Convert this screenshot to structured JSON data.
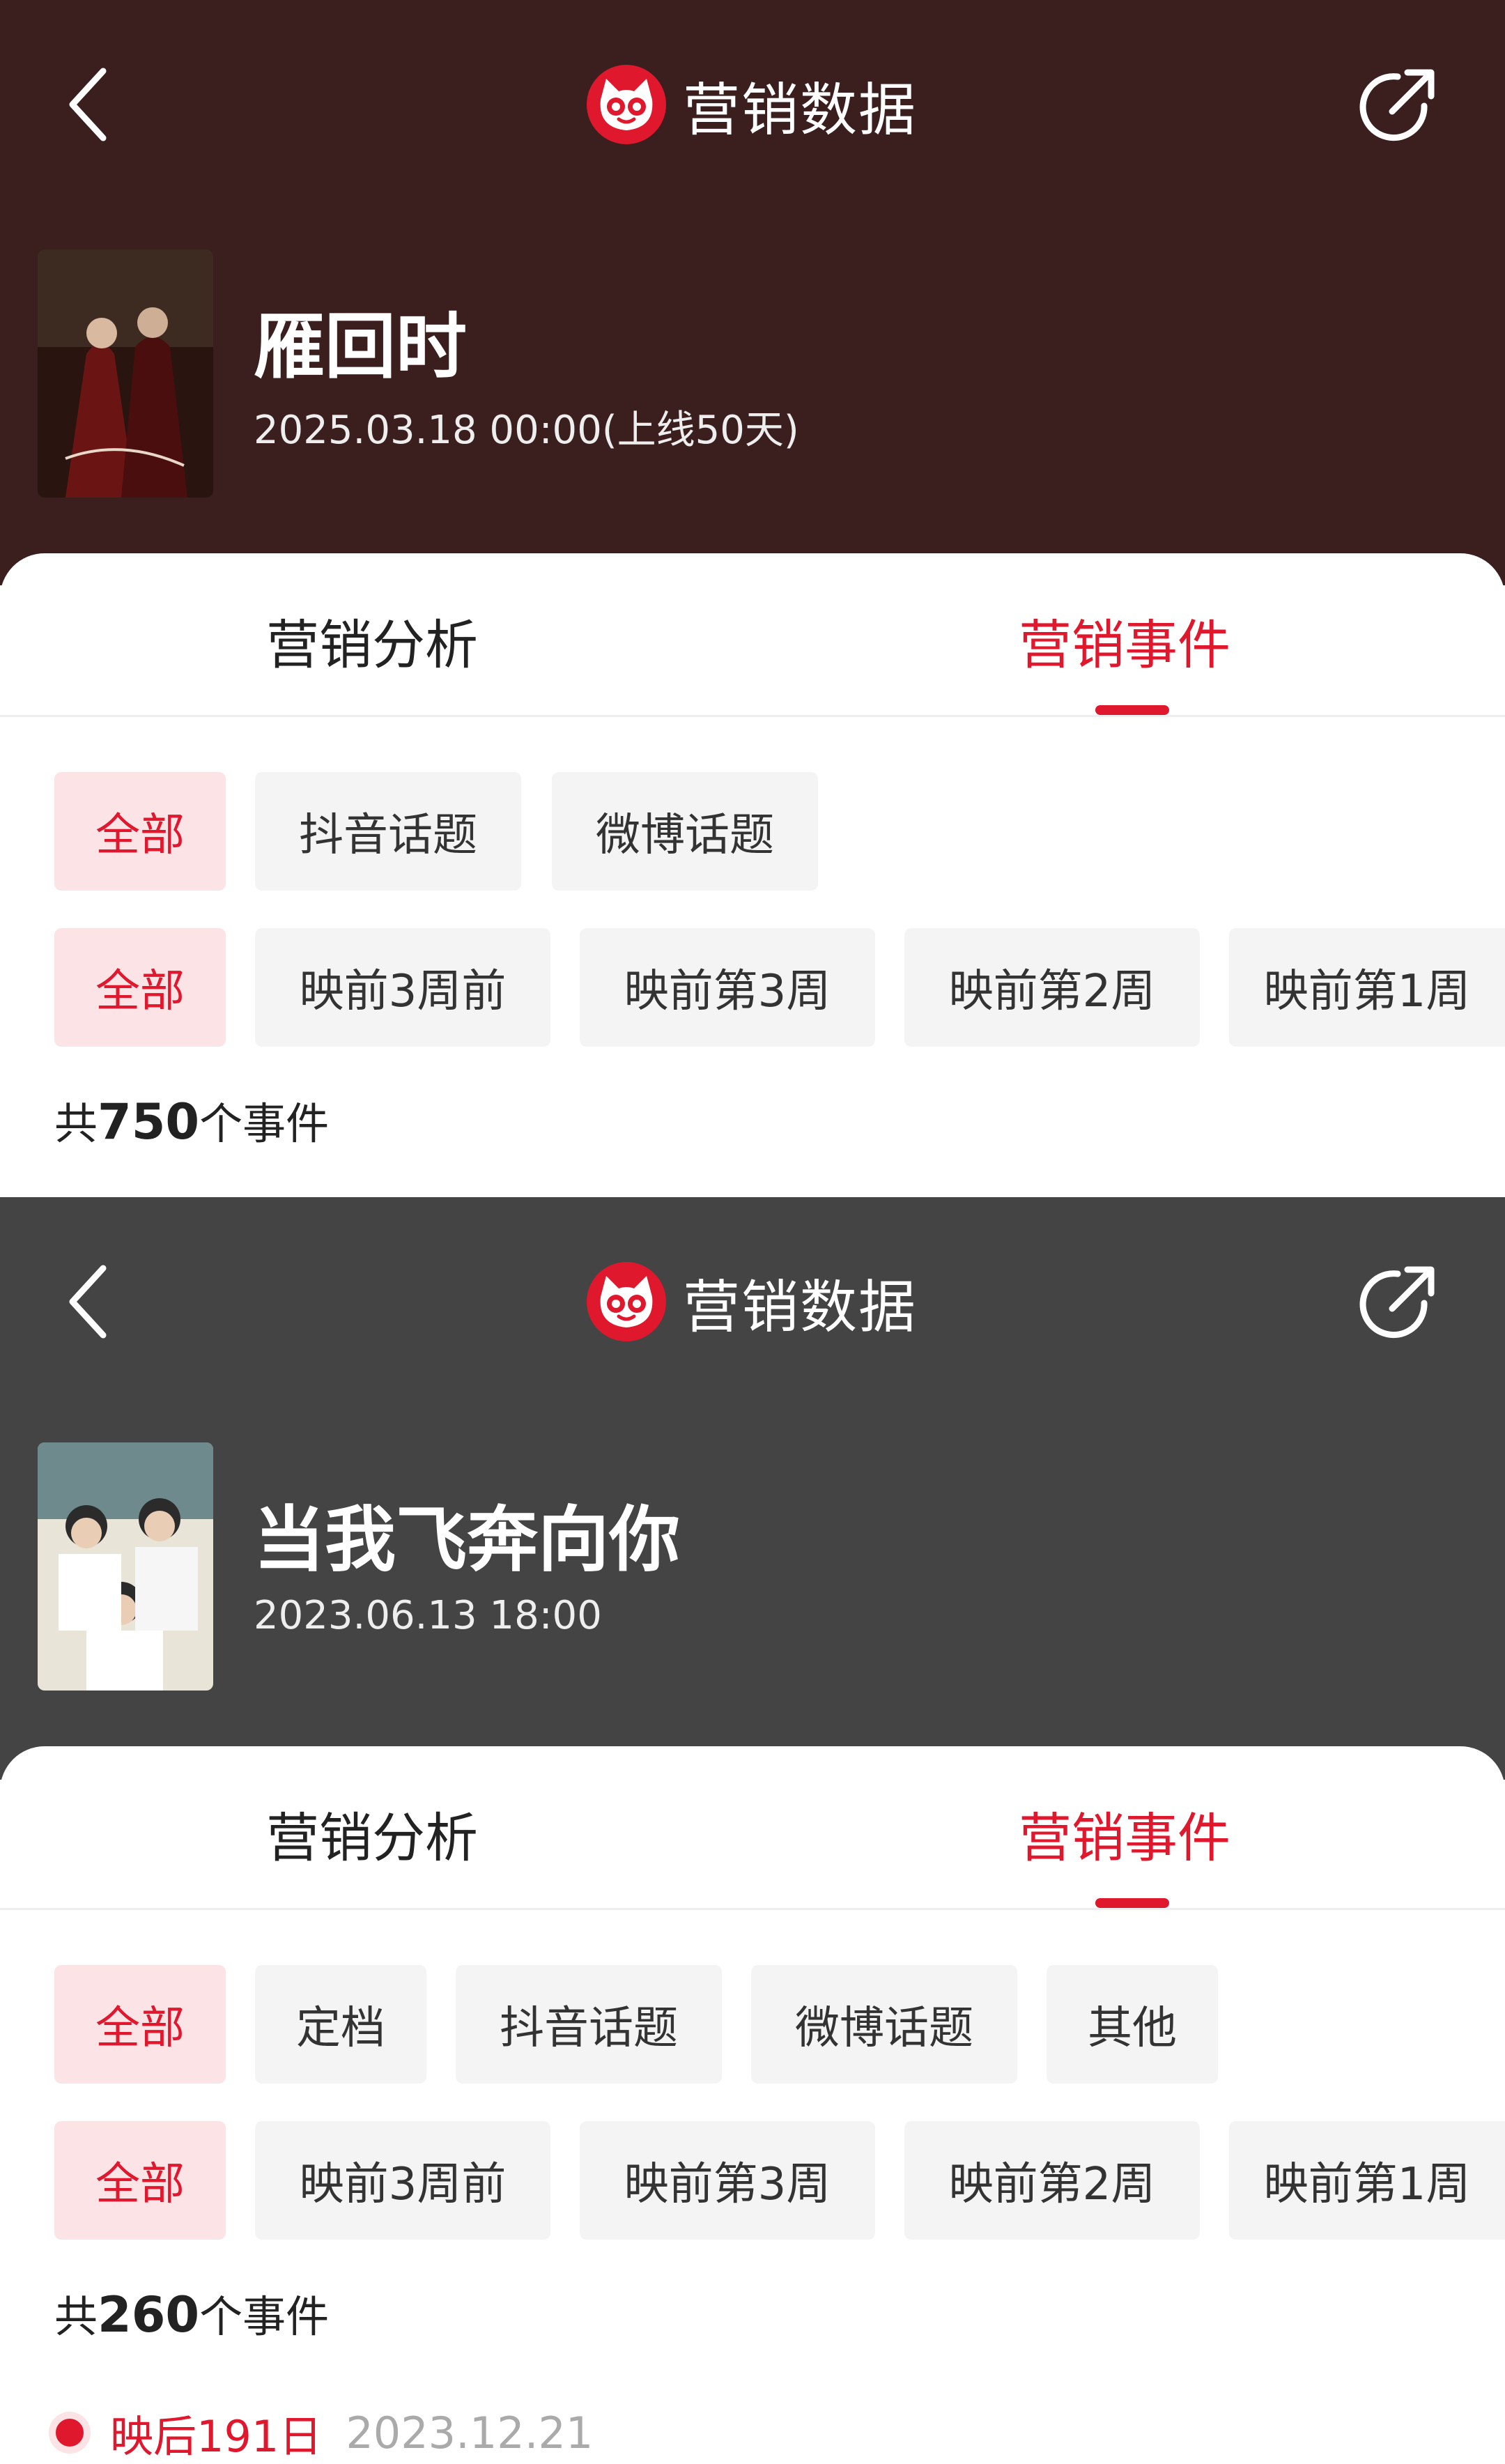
{
  "header": {
    "title": "营销数据"
  },
  "colors": {
    "accent": "#e0182d",
    "hero_bg_1": "#3b1f1f",
    "hero_bg_2": "#444444",
    "chip_active_bg": "#fbe3e6",
    "chip_bg": "#f4f4f4"
  },
  "icons": {
    "back": "chevron-left-icon",
    "share": "share-icon",
    "logo": "cat-logo-icon"
  },
  "panels": [
    {
      "movie": {
        "title": "雁回时",
        "date": "2025.03.18 00:00(上线50天)"
      },
      "tabs": [
        {
          "label": "营销分析",
          "active": false
        },
        {
          "label": "营销事件",
          "active": true
        }
      ],
      "filters_platform": [
        {
          "label": "全部",
          "active": true
        },
        {
          "label": "抖音话题",
          "active": false
        },
        {
          "label": "微博话题",
          "active": false
        }
      ],
      "filters_period": [
        {
          "label": "全部",
          "active": true
        },
        {
          "label": "映前3周前",
          "active": false
        },
        {
          "label": "映前第3周",
          "active": false
        },
        {
          "label": "映前第2周",
          "active": false
        },
        {
          "label": "映前第1周",
          "active": false
        }
      ],
      "count": {
        "prefix": "共",
        "number": "750",
        "suffix": "个事件"
      }
    },
    {
      "movie": {
        "title": "当我飞奔向你",
        "date": "2023.06.13 18:00"
      },
      "tabs": [
        {
          "label": "营销分析",
          "active": false
        },
        {
          "label": "营销事件",
          "active": true
        }
      ],
      "filters_platform": [
        {
          "label": "全部",
          "active": true
        },
        {
          "label": "定档",
          "active": false
        },
        {
          "label": "抖音话题",
          "active": false
        },
        {
          "label": "微博话题",
          "active": false
        },
        {
          "label": "其他",
          "active": false
        }
      ],
      "filters_period": [
        {
          "label": "全部",
          "active": true
        },
        {
          "label": "映前3周前",
          "active": false
        },
        {
          "label": "映前第3周",
          "active": false
        },
        {
          "label": "映前第2周",
          "active": false
        },
        {
          "label": "映前第1周",
          "active": false
        }
      ],
      "count": {
        "prefix": "共",
        "number": "260",
        "suffix": "个事件"
      },
      "timeline_first": {
        "day_label": "映后191日",
        "date": "2023.12.21"
      }
    }
  ]
}
